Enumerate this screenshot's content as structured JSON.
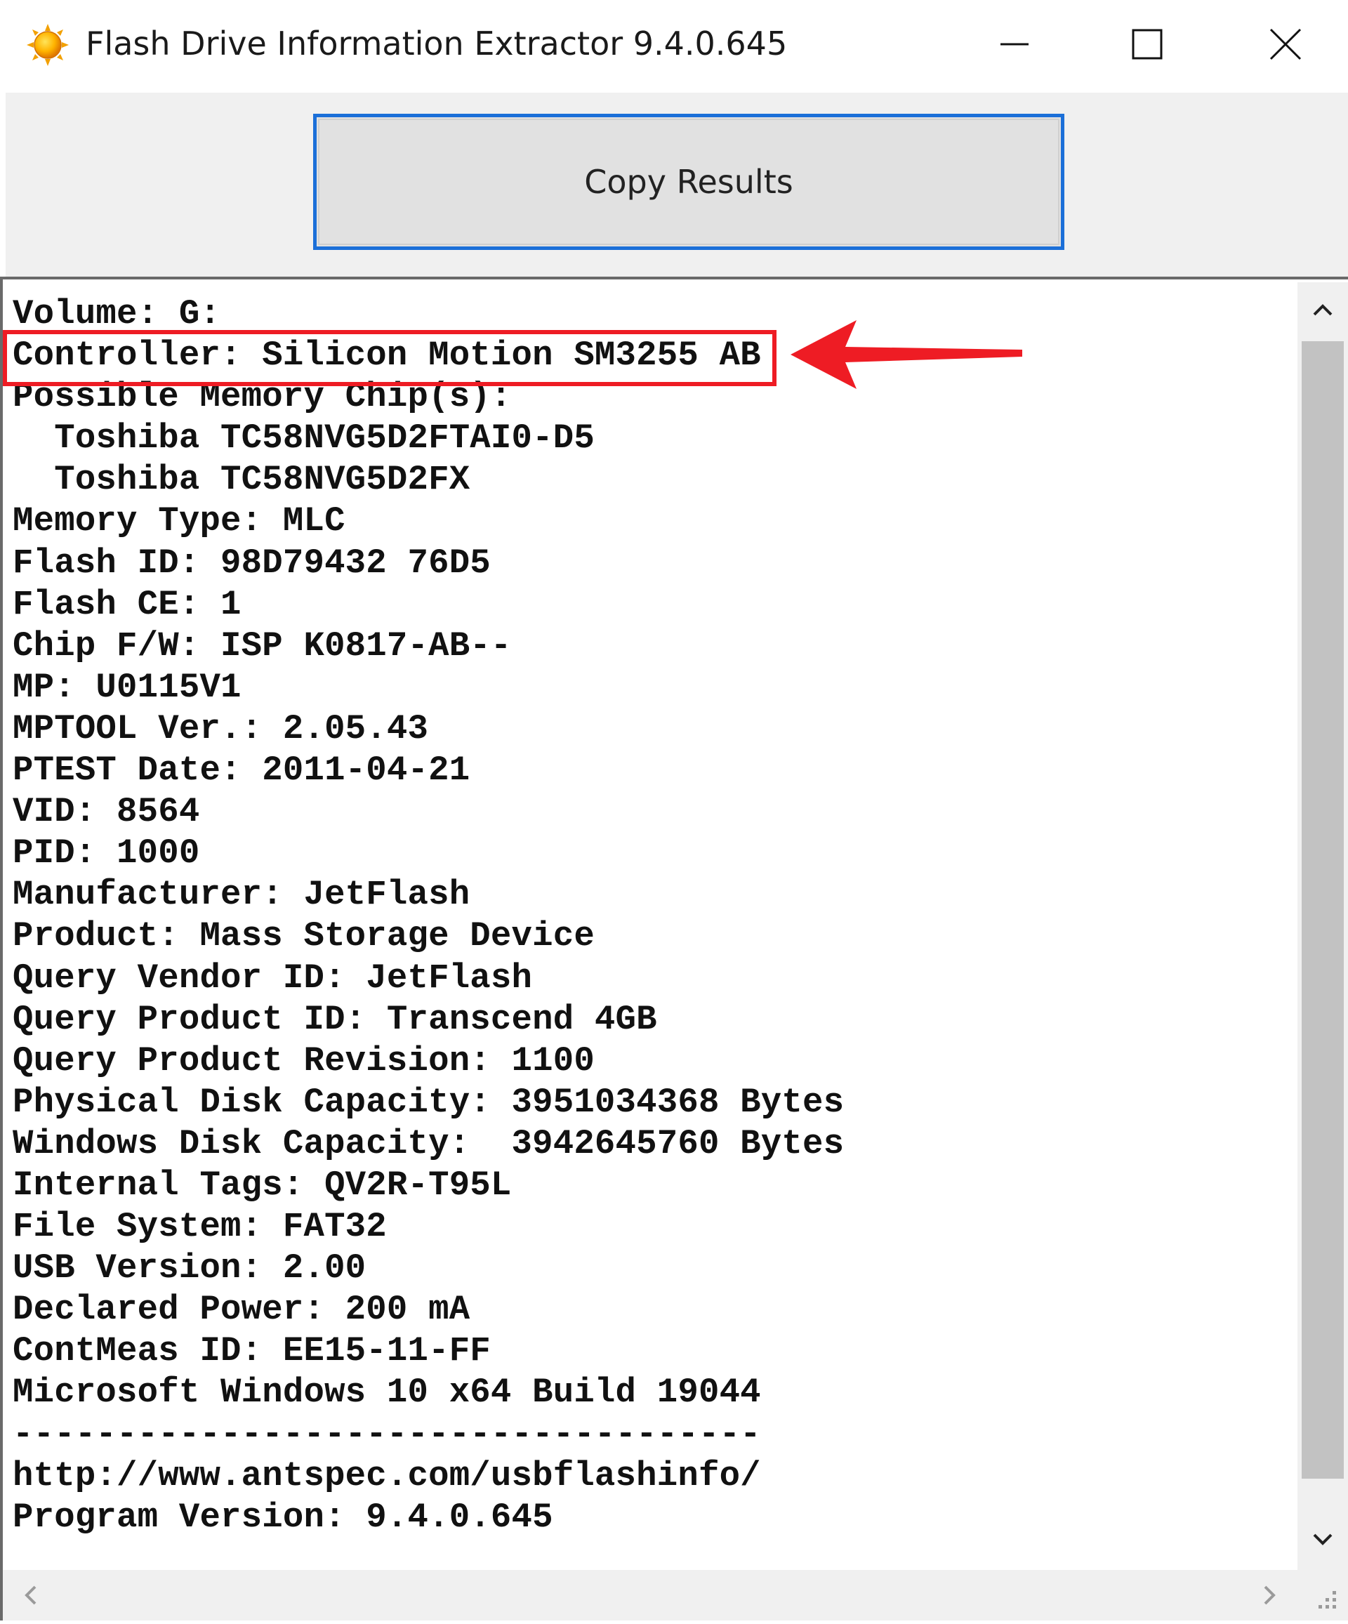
{
  "window": {
    "title": "Flash Drive Information Extractor 9.4.0.645",
    "icon": "sun-icon"
  },
  "toolbar": {
    "copy_label": "Copy Results"
  },
  "results": {
    "lines": [
      "Volume: G:",
      "Controller: Silicon Motion SM3255 AB",
      "Possible Memory Chip(s):",
      "  Toshiba TC58NVG5D2FTAI0-D5",
      "  Toshiba TC58NVG5D2FX",
      "Memory Type: MLC",
      "Flash ID: 98D79432 76D5",
      "Flash CE: 1",
      "Chip F/W: ISP K0817-AB--",
      "MP: U0115V1",
      "MPTOOL Ver.: 2.05.43",
      "PTEST Date: 2011-04-21",
      "VID: 8564",
      "PID: 1000",
      "Manufacturer: JetFlash",
      "Product: Mass Storage Device",
      "Query Vendor ID: JetFlash",
      "Query Product ID: Transcend 4GB",
      "Query Product Revision: 1100",
      "Physical Disk Capacity: 3951034368 Bytes",
      "Windows Disk Capacity:  3942645760 Bytes",
      "Internal Tags: QV2R-T95L",
      "File System: FAT32",
      "USB Version: 2.00",
      "Declared Power: 200 mA",
      "ContMeas ID: EE15-11-FF",
      "Microsoft Windows 10 x64 Build 19044",
      "------------------------------------",
      "http://www.antspec.com/usbflashinfo/",
      "Program Version: 9.4.0.645"
    ]
  },
  "annotation": {
    "highlight_color": "#ee1c24",
    "highlighted_line": "Controller: Silicon Motion SM3255 AB"
  },
  "colors": {
    "button_border": "#1b6fd8",
    "button_fill": "#e1e1e1",
    "toolbar_bg": "#f0f0f0",
    "scroll_thumb": "#c2c2c2"
  }
}
